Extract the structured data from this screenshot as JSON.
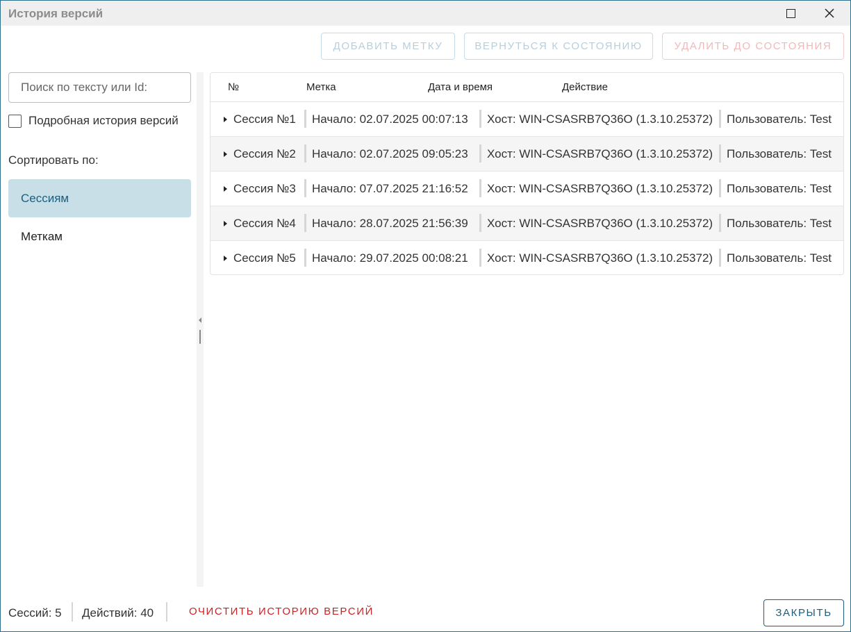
{
  "window": {
    "title": "История версий"
  },
  "toolbar": {
    "add_tag_label": "ДОБАВИТЬ МЕТКУ",
    "revert_label": "ВЕРНУТЬСЯ К СОСТОЯНИЮ",
    "delete_label": "УДАЛИТЬ ДО СОСТОЯНИЯ"
  },
  "sidebar": {
    "search_placeholder": "Поиск по тексту или Id:",
    "detailed_history_label": "Подробная история версий",
    "sort_by_label": "Сортировать по:",
    "sort_options": [
      {
        "label": "Сессиям",
        "selected": true
      },
      {
        "label": "Меткам",
        "selected": false
      }
    ]
  },
  "table": {
    "columns": [
      "№",
      "Метка",
      "Дата и время",
      "Действие"
    ],
    "rows": [
      {
        "session": "Сессия №1",
        "start": "Начало: 02.07.2025 00:07:13",
        "host": "Хост: WIN-CSASRB7Q36O (1.3.10.25372)",
        "user": "Пользователь: Test"
      },
      {
        "session": "Сессия №2",
        "start": "Начало: 02.07.2025 09:05:23",
        "host": "Хост: WIN-CSASRB7Q36O (1.3.10.25372)",
        "user": "Пользователь: Test"
      },
      {
        "session": "Сессия №3",
        "start": "Начало: 07.07.2025 21:16:52",
        "host": "Хост: WIN-CSASRB7Q36O (1.3.10.25372)",
        "user": "Пользователь: Test"
      },
      {
        "session": "Сессия №4",
        "start": "Начало: 28.07.2025 21:56:39",
        "host": "Хост: WIN-CSASRB7Q36O (1.3.10.25372)",
        "user": "Пользователь: Test"
      },
      {
        "session": "Сессия №5",
        "start": "Начало: 29.07.2025 00:08:21",
        "host": "Хост: WIN-CSASRB7Q36O (1.3.10.25372)",
        "user": "Пользователь: Test"
      }
    ]
  },
  "footer": {
    "sessions_count": "Сессий: 5",
    "actions_count": "Действий: 40",
    "clear_label": "ОЧИСТИТЬ ИСТОРИЮ ВЕРСИЙ",
    "close_label": "ЗАКРЫТЬ"
  },
  "colors": {
    "accent": "#1d5d7e",
    "selected_bg": "#c9dfe8",
    "danger": "#cc2222"
  },
  "icons": {
    "maximize": "maximize-icon",
    "close": "close-icon",
    "expand": "caret-right-icon"
  }
}
